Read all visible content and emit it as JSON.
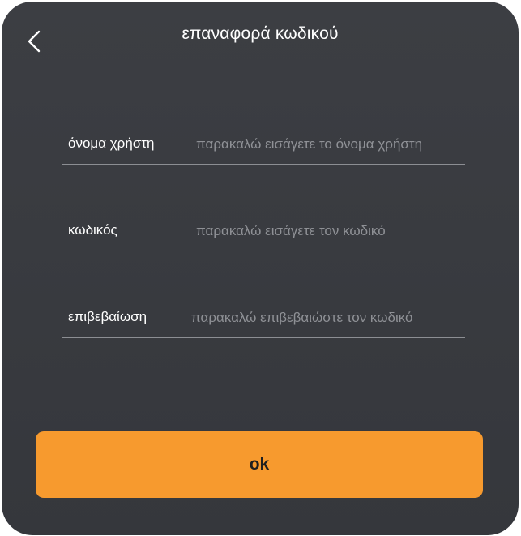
{
  "header": {
    "title": "επαναφορά κωδικού",
    "back_icon": "chevron-left-icon"
  },
  "form": {
    "username": {
      "label": "όνομα χρήστη",
      "value": "",
      "placeholder": "παρακαλώ εισάγετε το όνομα χρήστη"
    },
    "password": {
      "label": "κωδικός",
      "value": "",
      "placeholder": "παρακαλώ εισάγετε τον κωδικό"
    },
    "confirm": {
      "label": "επιβεβαίωση",
      "value": "",
      "placeholder": "παρακαλώ επιβεβαιώστε τον κωδικό"
    }
  },
  "actions": {
    "ok_label": "ok"
  },
  "colors": {
    "background": "#3a3c41",
    "accent": "#f79a2e",
    "divider": "#8c8e93",
    "placeholder": "#8f9196"
  }
}
